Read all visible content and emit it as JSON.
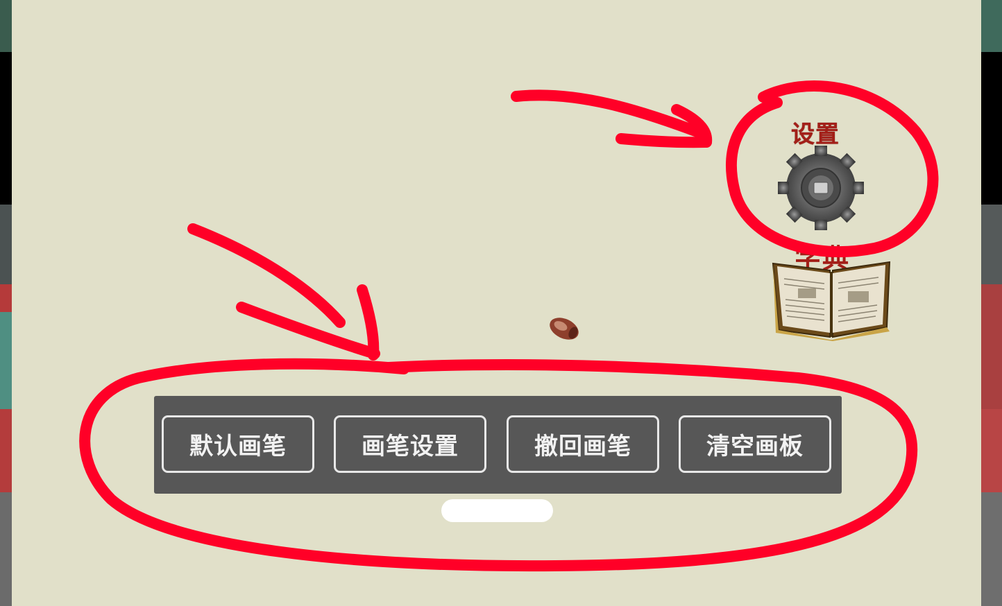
{
  "settings": {
    "label": "设置",
    "icon": "gear-icon"
  },
  "dictionary": {
    "label": "字典",
    "icon": "book-icon"
  },
  "toolbar": {
    "buttons": [
      {
        "label": "默认画笔"
      },
      {
        "label": "画笔设置"
      },
      {
        "label": "撤回画笔"
      },
      {
        "label": "清空画板"
      }
    ]
  },
  "colors": {
    "board": "#e1e0c9",
    "toolbar": "#575757",
    "label_red": "#a31f18",
    "annotation_red": "#ff0027"
  }
}
